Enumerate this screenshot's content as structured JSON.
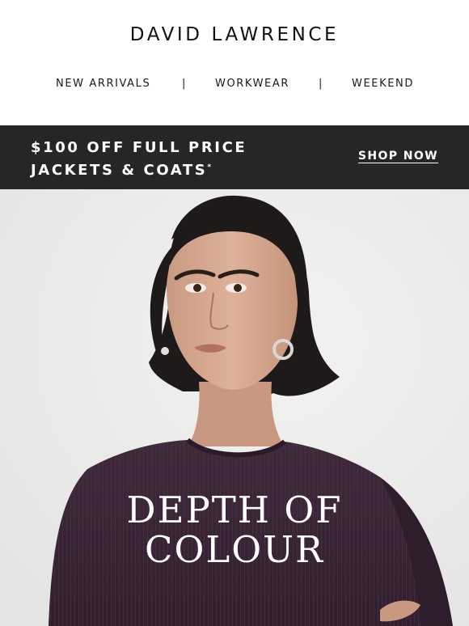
{
  "header": {
    "brand": "DAVID LAWRENCE",
    "nav": [
      "NEW ARRIVALS",
      "WORKWEAR",
      "WEEKEND"
    ],
    "separator": "|"
  },
  "promo": {
    "line1": "$100 OFF FULL PRICE",
    "line2": "JACKETS & COATS",
    "footnote_mark": "*",
    "cta": "SHOP NOW",
    "background": "#262626",
    "text_color": "#ffffff"
  },
  "hero": {
    "title_line1": "DEPTH OF",
    "title_line2": "COLOUR",
    "background": "#ebebeb",
    "sweater_color": "#3b2637"
  }
}
